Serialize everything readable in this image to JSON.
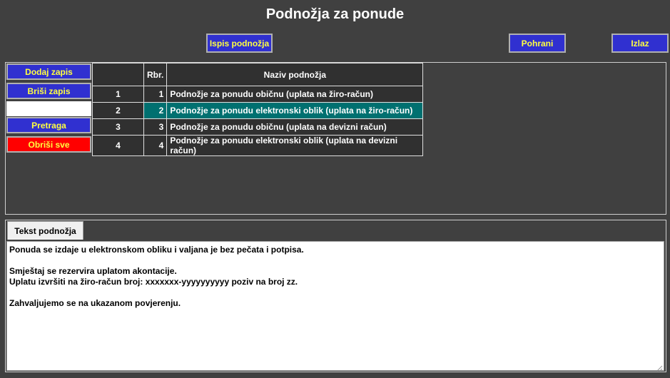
{
  "title": "Podnožja za ponude",
  "toolbar": {
    "print_label": "Ispis podnožja",
    "save_label": "Pohrani",
    "exit_label": "Izlaz"
  },
  "sidebar": {
    "add_label": "Dodaj zapis",
    "delete_label": "Briši zapis",
    "search_label": "Pretraga",
    "clear_label": "Obriši sve"
  },
  "table": {
    "headers": [
      "",
      "Rbr.",
      "Naziv podnožja"
    ],
    "rows": [
      {
        "idx": "1",
        "rbr": "1",
        "naziv": "Podnožje za ponudu običnu (uplata na žiro-račun)"
      },
      {
        "idx": "2",
        "rbr": "2",
        "naziv": "Podnožje za ponudu elektronski oblik (uplata na žiro-račun)"
      },
      {
        "idx": "3",
        "rbr": "3",
        "naziv": "Podnožje za ponudu običnu (uplata na devizni račun)"
      },
      {
        "idx": "4",
        "rbr": "4",
        "naziv": "Podnožje za ponudu elektronski oblik (uplata na devizni račun)"
      }
    ],
    "selected_index": 1
  },
  "tab": {
    "label": "Tekst podnožja"
  },
  "footer_text": "Ponuda se izdaje u elektronskom obliku i valjana je bez pečata i potpisa.\n\nSmještaj se rezervira uplatom akontacije.\nUplatu izvršiti na žiro-račun broj: xxxxxxx-yyyyyyyyyy poziv na broj zz.\n\nZahvaljujemo se na ukazanom povjerenju.",
  "colors": {
    "background": "#404040",
    "button": "#3030d0",
    "button_text": "#ffff40",
    "danger": "#ff0000",
    "selected_row": "#007070"
  }
}
